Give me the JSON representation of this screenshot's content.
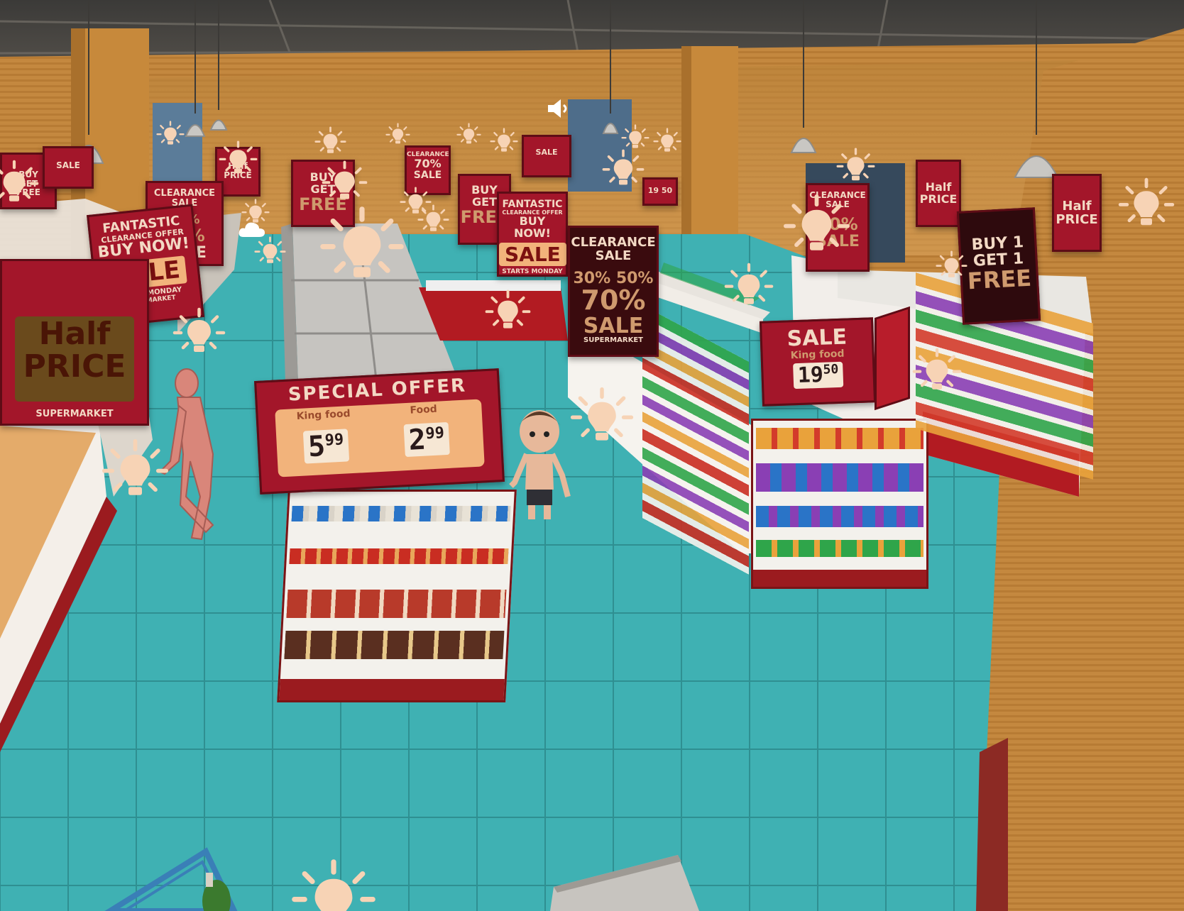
{
  "signs": {
    "special_offer": {
      "title": "SPECIAL OFFER",
      "item1_label": "King food",
      "item1_price_main": "5",
      "item1_price_cents": "99",
      "item2_label": "Food",
      "item2_price_main": "2",
      "item2_price_cents": "99"
    },
    "sale_king": {
      "title": "SALE",
      "label": "King food",
      "price_main": "19",
      "price_cents": "50"
    },
    "half_price_left": {
      "line1": "Half",
      "line2": "PRICE",
      "footer": "SUPERMARKET"
    },
    "fantastic_left": {
      "line1": "FANTASTIC",
      "line2": "CLEARANCE OFFER",
      "line3": "BUY NOW!",
      "sale": "SALE",
      "starts": "STARTS MONDAY",
      "footer": "SUPERMARKET"
    },
    "fantastic_center": {
      "line1": "FANTASTIC",
      "line2": "CLEARANCE OFFER",
      "line3": "BUY NOW!",
      "sale": "SALE",
      "starts": "STARTS MONDAY"
    },
    "clearance_center": {
      "line1": "CLEARANCE",
      "line2": "SALE",
      "percents": "30% 50%",
      "big": "70%",
      "sale": "SALE",
      "footer": "SUPERMARKET"
    },
    "clearance_left": {
      "line1": "CLEARANCE",
      "line2": "SALE",
      "percents": "50%",
      "big": "70%",
      "sale": "SALE"
    },
    "clearance_right": {
      "line1": "CLEARANCE",
      "line2": "SALE",
      "big": "70%",
      "sale": "SALE"
    },
    "bogof_center": {
      "line1": "BUY",
      "line2": "GET",
      "line3": "FREE"
    },
    "bogof_right": {
      "line1": "BUY 1",
      "line2": "GET 1",
      "line3": "FREE"
    },
    "bogof_far": {
      "line1": "BUY",
      "line2": "GET",
      "line3": "FREE"
    },
    "half_price_right1": {
      "line1": "Half",
      "line2": "PRICE"
    },
    "half_price_right2": {
      "line1": "Half",
      "line2": "PRICE"
    },
    "half_price_far": {
      "line1": "Half",
      "line2": "PRICE"
    },
    "small_price_far": {
      "price": "19 50"
    },
    "far_sale_1": {
      "text": "SALE"
    },
    "far_sale_2": {
      "text": "SALE"
    }
  },
  "colors": {
    "floor": "#3fb1b3",
    "wall": "#d1974a",
    "sign_red": "#a3162a",
    "sign_text": "#f3d9c4",
    "bulb_icon": "#f7d3b5"
  },
  "icons": [
    "light-bulb-icon",
    "speaker-icon",
    "cloud-icon"
  ]
}
